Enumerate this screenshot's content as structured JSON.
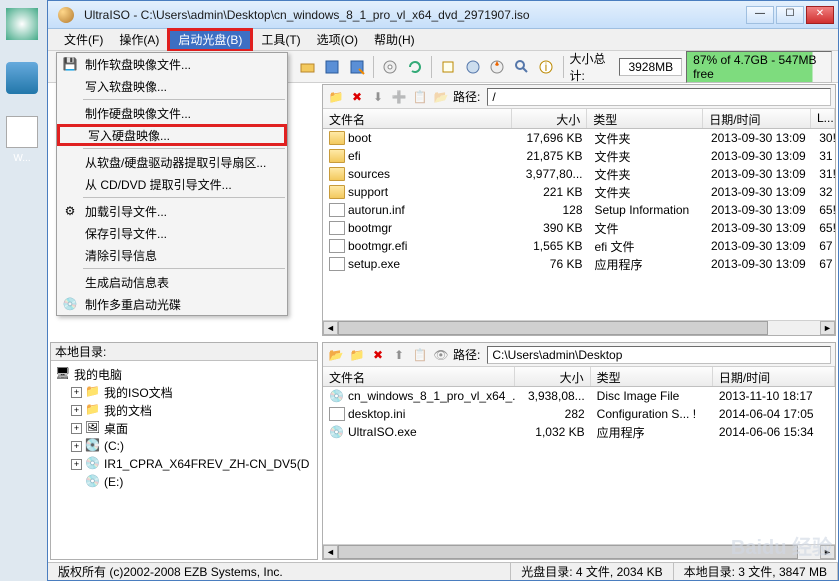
{
  "titlebar": {
    "title": "UltraISO - C:\\Users\\admin\\Desktop\\cn_windows_8_1_pro_vl_x64_dvd_2971907.iso"
  },
  "menu": {
    "file": "文件(F)",
    "action": "操作(A)",
    "boot": "启动光盘(B)",
    "tools": "工具(T)",
    "options": "选项(O)",
    "help": "帮助(H)"
  },
  "dropdown": {
    "makeFloppyImg": "制作软盘映像文件...",
    "writeFloppyImg": "写入软盘映像...",
    "makeHddImg": "制作硬盘映像文件...",
    "writeHddImg": "写入硬盘映像...",
    "extractFloppy": "从软盘/硬盘驱动器提取引导扇区...",
    "extractCddvd": "从 CD/DVD 提取引导文件...",
    "loadBootFile": "加载引导文件...",
    "saveBootFile": "保存引导文件...",
    "clearBootInfo": "清除引导信息",
    "makeBootInfoTable": "生成启动信息表",
    "makeMultiBoot": "制作多重启动光碟"
  },
  "toolbar": {
    "sizeTotalLabel": "大小总计:",
    "sizeTotalValue": "3928MB",
    "freeText": "87% of 4.7GB - 547MB free"
  },
  "miniToolbar": {
    "pathLabel": "路径:"
  },
  "topPane": {
    "path": "/",
    "headers": {
      "name": "文件名",
      "size": "大小",
      "type": "类型",
      "date": "日期/时间",
      "l": "L..."
    },
    "rows": [
      {
        "icon": "folder",
        "name": "boot",
        "size": "17,696 KB",
        "type": "文件夹",
        "date": "2013-09-30 13:09",
        "l": "30!"
      },
      {
        "icon": "folder",
        "name": "efi",
        "size": "21,875 KB",
        "type": "文件夹",
        "date": "2013-09-30 13:09",
        "l": "31"
      },
      {
        "icon": "folder",
        "name": "sources",
        "size": "3,977,80...",
        "type": "文件夹",
        "date": "2013-09-30 13:09",
        "l": "31!"
      },
      {
        "icon": "folder",
        "name": "support",
        "size": "221 KB",
        "type": "文件夹",
        "date": "2013-09-30 13:09",
        "l": "32"
      },
      {
        "icon": "file",
        "name": "autorun.inf",
        "size": "128",
        "type": "Setup Information",
        "date": "2013-09-30 13:09",
        "l": "65!"
      },
      {
        "icon": "file",
        "name": "bootmgr",
        "size": "390 KB",
        "type": "文件",
        "date": "2013-09-30 13:09",
        "l": "65!"
      },
      {
        "icon": "file",
        "name": "bootmgr.efi",
        "size": "1,565 KB",
        "type": "efi 文件",
        "date": "2013-09-30 13:09",
        "l": "67"
      },
      {
        "icon": "file",
        "name": "setup.exe",
        "size": "76 KB",
        "type": "应用程序",
        "date": "2013-09-30 13:09",
        "l": "67"
      }
    ]
  },
  "leftBottom": {
    "header": "本地目录:",
    "nodes": {
      "myComputer": "我的电脑",
      "myIso": "我的ISO文档",
      "myDocs": "我的文档",
      "desktop": "桌面",
      "c": "(C:)",
      "d": "IR1_CPRA_X64FREV_ZH-CN_DV5(D",
      "e": "(E:)"
    }
  },
  "bottomPane": {
    "path": "C:\\Users\\admin\\Desktop",
    "headers": {
      "name": "文件名",
      "size": "大小",
      "type": "类型",
      "date": "日期/时间"
    },
    "rows": [
      {
        "icon": "disc",
        "name": "cn_windows_8_1_pro_vl_x64_...",
        "size": "3,938,08...",
        "type": "Disc Image File",
        "date": "2013-11-10 18:17"
      },
      {
        "icon": "file",
        "name": "desktop.ini",
        "size": "282",
        "type": "Configuration S... !",
        "date": "2014-06-04 17:05"
      },
      {
        "icon": "disc",
        "name": "UltraISO.exe",
        "size": "1,032 KB",
        "type": "应用程序",
        "date": "2014-06-06 15:34"
      }
    ]
  },
  "statusbar": {
    "copyright": "版权所有 (c)2002-2008 EZB Systems, Inc.",
    "diskDir": "光盘目录: 4 文件, 2034 KB",
    "localDir": "本地目录: 3 文件, 3847 MB"
  },
  "desktop": {
    "w": "W..."
  },
  "watermark": "Baidu 经验"
}
